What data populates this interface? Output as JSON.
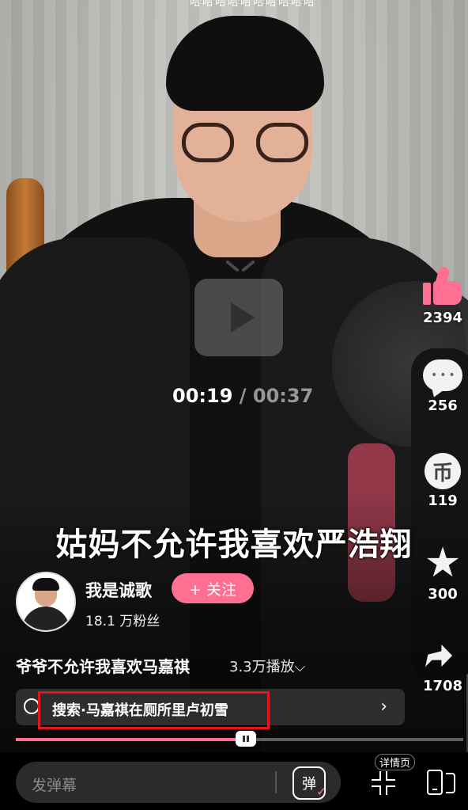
{
  "top_marquee": "哈哈哈哈哈哈哈哈哈哈",
  "player": {
    "current_time": "00:19",
    "separator": "/",
    "total_time": "00:37",
    "progress_fraction": 0.514
  },
  "subtitle": "姑妈不允许我喜欢严浩翔",
  "author": {
    "name": "我是诚歌",
    "follow_label": "+ 关注",
    "fans": "18.1 万粉丝"
  },
  "video": {
    "title": "爷爷不允许我喜欢马嘉祺",
    "plays": "3.3万播放"
  },
  "search": {
    "text": "搜索·马嘉祺在厕所里卢初雪"
  },
  "actions": {
    "likes": "2394",
    "comments": "256",
    "coins": "119",
    "favorites": "300",
    "shares": "1708",
    "coin_glyph": "币"
  },
  "bottom_bar": {
    "danmaku_placeholder": "发弹幕",
    "danmaku_button": "弹",
    "detail_label": "详情页"
  },
  "colors": {
    "accent": "#ff6f91",
    "highlight_box": "#e5161a"
  }
}
